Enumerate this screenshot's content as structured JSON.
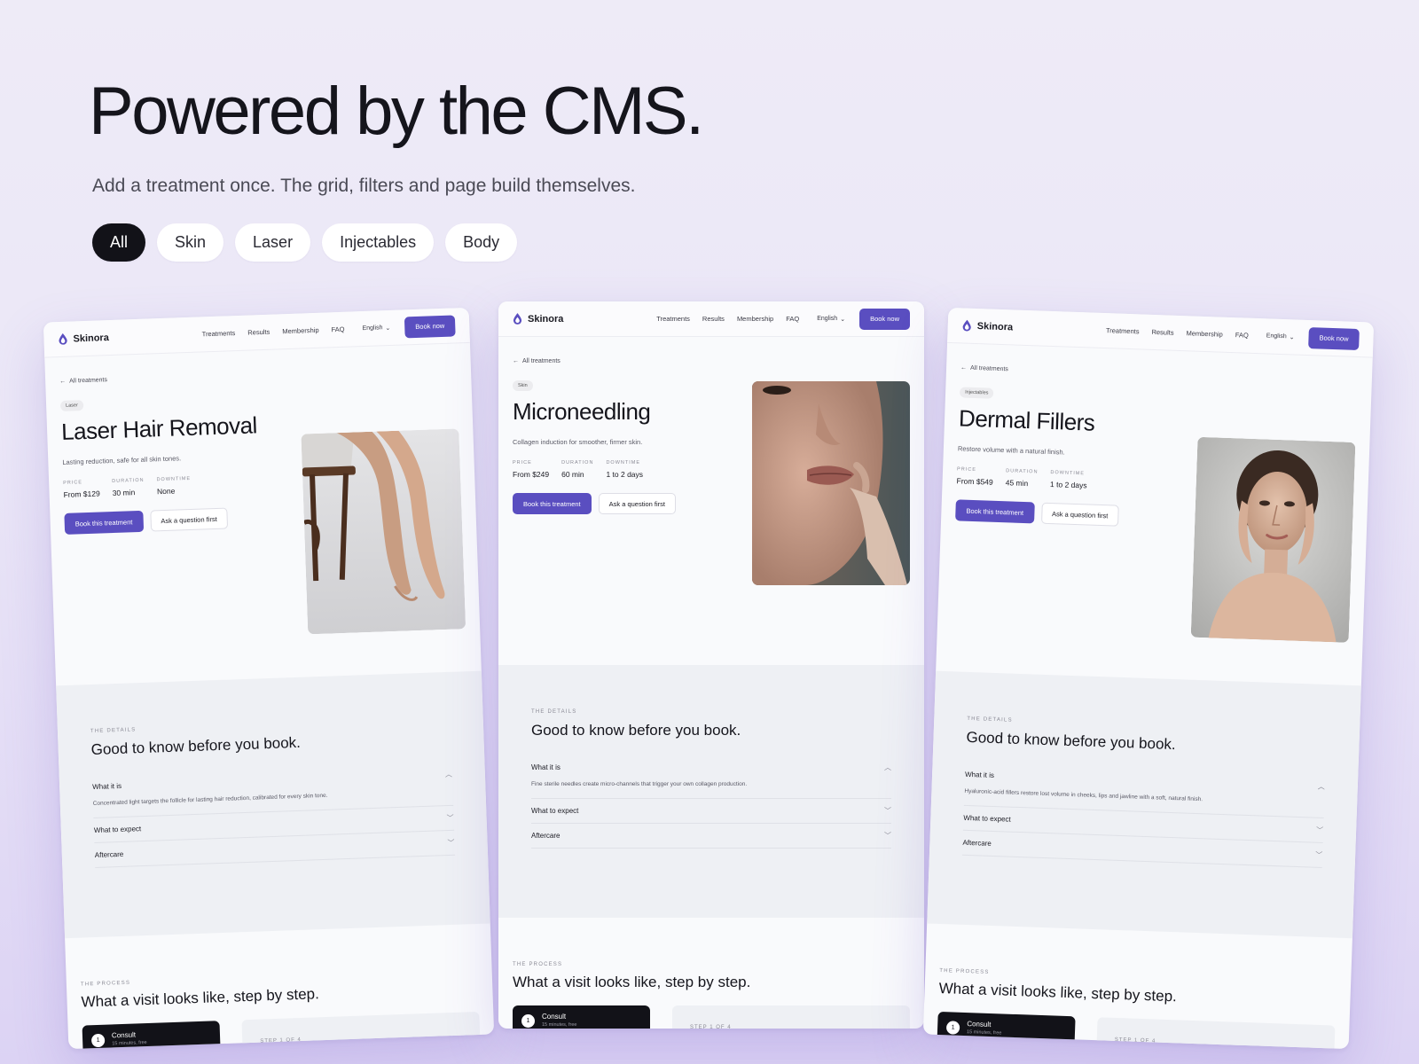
{
  "hero": {
    "title": "Powered by the CMS.",
    "subtitle": "Add a treatment once. The grid, filters and page build themselves."
  },
  "filters": [
    {
      "label": "All",
      "active": true
    },
    {
      "label": "Skin",
      "active": false
    },
    {
      "label": "Laser",
      "active": false
    },
    {
      "label": "Injectables",
      "active": false
    },
    {
      "label": "Body",
      "active": false
    }
  ],
  "colors": {
    "accent": "#5a4ec0",
    "dark": "#121218",
    "background": "#ece8f7"
  },
  "cards": [
    {
      "brand": "Skinora",
      "nav": {
        "links": [
          "Treatments",
          "Results",
          "Membership",
          "FAQ"
        ],
        "language": "English",
        "cta": "Book now"
      },
      "back": "All treatments",
      "tag": "Laser",
      "title": "Laser Hair Removal",
      "subtitle": "Lasting reduction, safe for all skin tones.",
      "meta": [
        {
          "label": "PRICE",
          "value": "From $129"
        },
        {
          "label": "DURATION",
          "value": "30 min"
        },
        {
          "label": "DOWNTIME",
          "value": "None"
        }
      ],
      "cta_primary": "Book this treatment",
      "cta_secondary": "Ask a question first",
      "image": "legs-on-chair-photo",
      "details": {
        "eyebrow": "THE DETAILS",
        "title": "Good to know before you book.",
        "items": [
          {
            "head": "What it is",
            "body": "Concentrated light targets the follicle for lasting hair reduction, calibrated for every skin tone."
          },
          {
            "head": "What to expect",
            "body": ""
          },
          {
            "head": "Aftercare",
            "body": ""
          }
        ]
      },
      "process": {
        "eyebrow": "THE PROCESS",
        "title": "What a visit looks like, step by step.",
        "step": {
          "num": "1",
          "name": "Consult",
          "note": "15 minutes, free"
        },
        "next": "STEP 1 OF 4"
      }
    },
    {
      "brand": "Skinora",
      "nav": {
        "links": [
          "Treatments",
          "Results",
          "Membership",
          "FAQ"
        ],
        "language": "English",
        "cta": "Book now"
      },
      "back": "All treatments",
      "tag": "Skin",
      "title": "Microneedling",
      "subtitle": "Collagen induction for smoother, firmer skin.",
      "meta": [
        {
          "label": "PRICE",
          "value": "From $249"
        },
        {
          "label": "DURATION",
          "value": "60 min"
        },
        {
          "label": "DOWNTIME",
          "value": "1 to 2 days"
        }
      ],
      "cta_primary": "Book this treatment",
      "cta_secondary": "Ask a question first",
      "image": "face-closeup-photo",
      "details": {
        "eyebrow": "THE DETAILS",
        "title": "Good to know before you book.",
        "items": [
          {
            "head": "What it is",
            "body": "Fine sterile needles create micro-channels that trigger your own collagen production."
          },
          {
            "head": "What to expect",
            "body": ""
          },
          {
            "head": "Aftercare",
            "body": ""
          }
        ]
      },
      "process": {
        "eyebrow": "THE PROCESS",
        "title": "What a visit looks like, step by step.",
        "step": {
          "num": "1",
          "name": "Consult",
          "note": "15 minutes, free"
        },
        "next": "STEP 1 OF 4"
      }
    },
    {
      "brand": "Skinora",
      "nav": {
        "links": [
          "Treatments",
          "Results",
          "Membership",
          "FAQ"
        ],
        "language": "English",
        "cta": "Book now"
      },
      "back": "All treatments",
      "tag": "Injectables",
      "title": "Dermal Fillers",
      "subtitle": "Restore volume with a natural finish.",
      "meta": [
        {
          "label": "PRICE",
          "value": "From $549"
        },
        {
          "label": "DURATION",
          "value": "45 min"
        },
        {
          "label": "DOWNTIME",
          "value": "1 to 2 days"
        }
      ],
      "cta_primary": "Book this treatment",
      "cta_secondary": "Ask a question first",
      "image": "woman-portrait-photo",
      "details": {
        "eyebrow": "THE DETAILS",
        "title": "Good to know before you book.",
        "items": [
          {
            "head": "What it is",
            "body": "Hyaluronic-acid fillers restore lost volume in cheeks, lips and jawline with a soft, natural finish."
          },
          {
            "head": "What to expect",
            "body": ""
          },
          {
            "head": "Aftercare",
            "body": ""
          }
        ]
      },
      "process": {
        "eyebrow": "THE PROCESS",
        "title": "What a visit looks like, step by step.",
        "step": {
          "num": "1",
          "name": "Consult",
          "note": "15 minutes, free"
        },
        "next": "STEP 1 OF 4"
      }
    }
  ]
}
